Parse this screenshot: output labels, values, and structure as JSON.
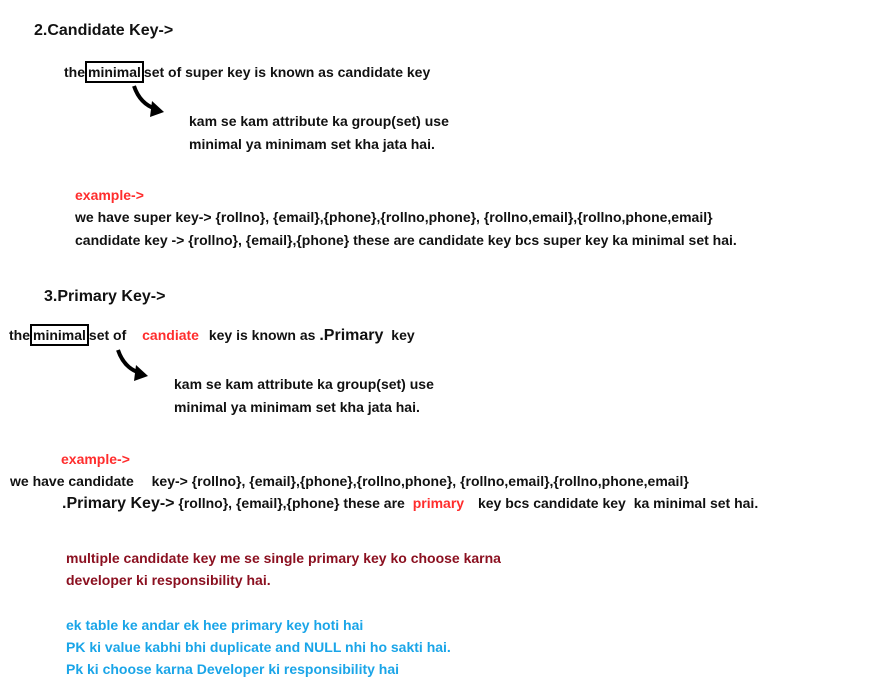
{
  "candidate_section": {
    "heading": "2.Candidate Key->",
    "def_prefix": "the",
    "def_boxed_word": "minimal",
    "def_suffix": "set of super key is known as candidate key",
    "note_line1": "kam se kam attribute ka group(set) use",
    "note_line2": "minimal ya minimam set kha jata hai.",
    "example_label": "example->",
    "example_line1": "we have super key-> {rollno}, {email},{phone},{rollno,phone}, {rollno,email},{rollno,phone,email}",
    "example_line2": "candidate key -> {rollno}, {email},{phone}  these are candidate key bcs super key ka minimal set hai."
  },
  "primary_section": {
    "heading": "3.Primary Key->",
    "def_prefix": "the",
    "def_boxed_word": "minimal",
    "def_mid": "set of",
    "def_red_word": "candiate",
    "def_after": "key is known as",
    "def_big_word": ".Primary",
    "def_end": "key",
    "note_line1": "kam se kam attribute ka group(set) use",
    "note_line2": "minimal ya minimam set kha jata hai.",
    "example_label": "example->",
    "example_line1_a": "we have",
    "example_line1_b": "candidate",
    "example_line1_c": "key-> {rollno}, {email},{phone},{rollno,phone}, {rollno,email},{rollno,phone,email}",
    "example_line2_big": ".Primary Key->",
    "example_line2_a": "{rollno}, {email},{phone}  these are",
    "example_line2_red": "primary",
    "example_line2_b": "key bcs",
    "example_line2_c": "candidate key",
    "example_line2_d": "ka minimal set hai.",
    "darkred_line1": "multiple candidate key me se single primary key ko choose karna",
    "darkred_line2": "developer ki responsibility hai.",
    "blue_line1": "ek table ke andar ek hee primary key hoti hai",
    "blue_line2": "PK ki value kabhi bhi duplicate and NULL nhi ho sakti hai.",
    "blue_line3": "Pk ki choose karna Developer ki responsibility hai"
  },
  "colors": {
    "red": "#ff2d2d",
    "dark_red": "#8b1020",
    "blue": "#1aa5e8",
    "text": "#111111"
  },
  "icons": [
    "curved-arrow-icon",
    "curved-arrow-icon"
  ]
}
